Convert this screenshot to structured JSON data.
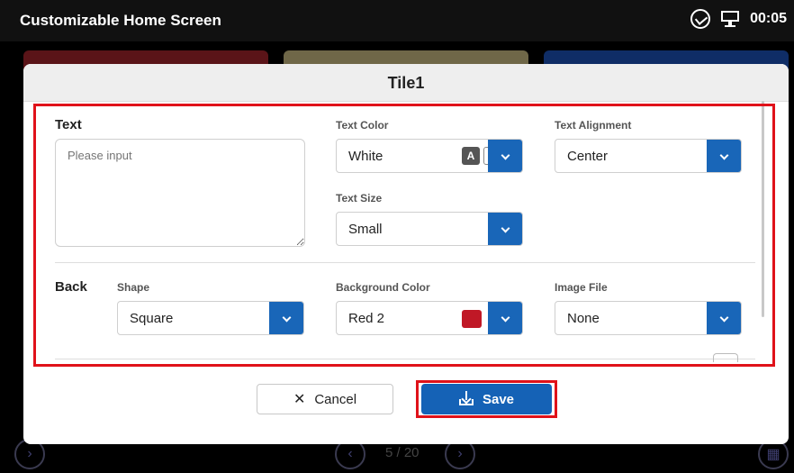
{
  "app": {
    "title": "Customizable Home Screen",
    "clock": "00:05"
  },
  "pager": {
    "text": "5 / 20"
  },
  "dialog": {
    "title": "Tile1",
    "text_section": {
      "label": "Text",
      "input_placeholder": "Please input",
      "text_color": {
        "label": "Text Color",
        "value": "White",
        "swatch_letter": "A",
        "swatch_color": "#ffffff"
      },
      "text_size": {
        "label": "Text Size",
        "value": "Small"
      },
      "text_alignment": {
        "label": "Text Alignment",
        "value": "Center"
      }
    },
    "back_section": {
      "label": "Back",
      "shape": {
        "label": "Shape",
        "value": "Square"
      },
      "background_color": {
        "label": "Background Color",
        "value": "Red 2",
        "swatch_color": "#c01826"
      },
      "image_file": {
        "label": "Image File",
        "value": "None"
      }
    },
    "buttons": {
      "cancel": "Cancel",
      "save": "Save"
    }
  },
  "colors": {
    "accent": "#1966b8",
    "highlight": "#e0121a"
  }
}
